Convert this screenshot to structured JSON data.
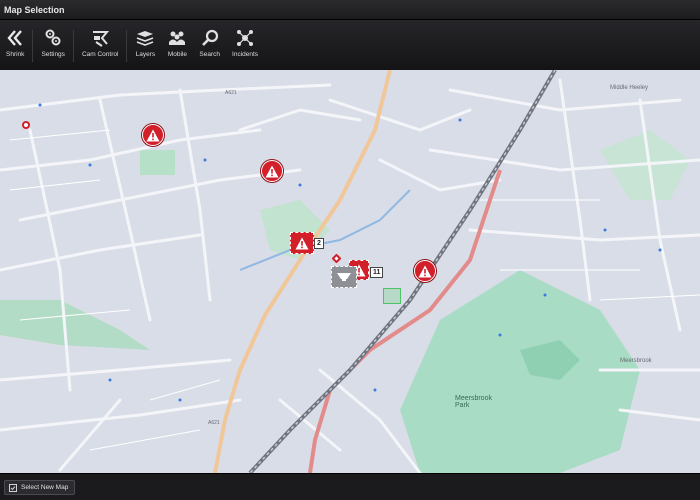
{
  "window": {
    "title": "Map Selection"
  },
  "toolbar": {
    "shrink": "Shrink",
    "settings": "Settings",
    "cam_control": "Cam Control",
    "layers": "Layers",
    "mobile": "Mobile",
    "search": "Search",
    "incidents": "Incidents"
  },
  "map": {
    "labels": {
      "a621_top": "A621",
      "a621_bottom": "A621",
      "meersbrook_park": "Meersbrook\nPark",
      "meersbrook": "Meersbrook",
      "middle_heeley": "Middle Heeley"
    },
    "badges": {
      "incident_group": "2",
      "camera_group": "11"
    },
    "colors": {
      "alert": "#d21f2a",
      "map_bg": "#d9dde7",
      "park": "#9fd6bd",
      "main_road": "#e38b8b",
      "rail": "#6f7480"
    }
  },
  "status": {
    "select_new_map": "Select New Map"
  }
}
